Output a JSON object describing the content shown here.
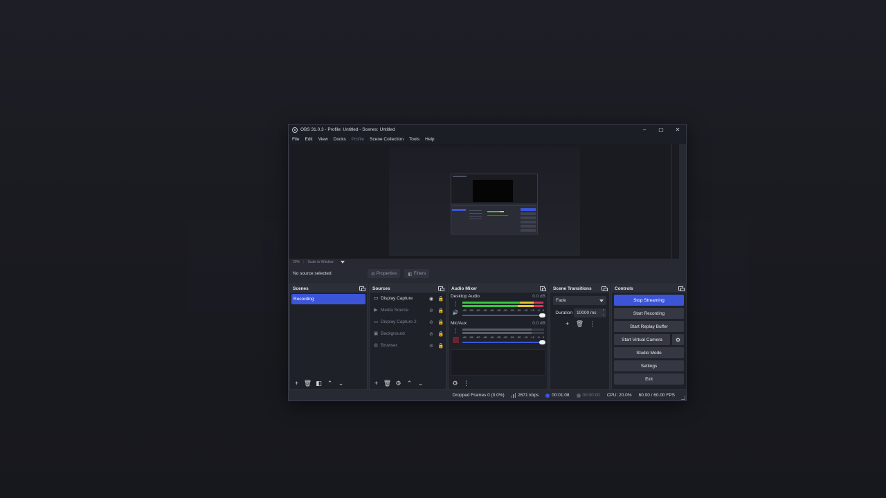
{
  "window": {
    "title": "OBS 31.0.3 - Profile: Untitled - Scenes: Untitled",
    "controls": {
      "minimize": "–",
      "maximize": "▢",
      "close": "✕"
    }
  },
  "menu": {
    "file": "File",
    "edit": "Edit",
    "view": "View",
    "docks": "Docks",
    "profile": "Profile",
    "scene_collection": "Scene Collection",
    "tools": "Tools",
    "help": "Help"
  },
  "preview": {
    "zoom": "20%",
    "scale_mode": "Scale to Window"
  },
  "properties_bar": {
    "no_source": "No source selected",
    "properties": "Properties",
    "filters": "Filters"
  },
  "scenes": {
    "title": "Scenes",
    "items": [
      {
        "label": "Recording",
        "selected": true
      }
    ]
  },
  "sources": {
    "title": "Sources",
    "items": [
      {
        "label": "Display Capture",
        "icon": "monitor-icon",
        "visible": true
      },
      {
        "label": "Media Source",
        "icon": "play-icon",
        "visible": false
      },
      {
        "label": "Display Capture 2",
        "icon": "monitor-icon",
        "visible": false
      },
      {
        "label": "Background",
        "icon": "image-icon",
        "visible": false
      },
      {
        "label": "Browser",
        "icon": "globe-icon",
        "visible": false
      }
    ]
  },
  "audio_mixer": {
    "title": "Audio Mixer",
    "ticks": [
      "-60",
      "-55",
      "-50",
      "-45",
      "-40",
      "-35",
      "-30",
      "-25",
      "-20",
      "-15",
      "-10",
      "-5",
      "0"
    ],
    "channels": [
      {
        "name": "Desktop Audio",
        "db": "0.0 dB",
        "muted": false,
        "volume": 1.0
      },
      {
        "name": "Mic/Aux",
        "db": "0.0 dB",
        "muted": true,
        "volume": 1.0
      }
    ]
  },
  "scene_transitions": {
    "title": "Scene Transitions",
    "transition": "Fade",
    "duration_label": "Duration",
    "duration_value": "10000 ms"
  },
  "controls": {
    "title": "Controls",
    "stop_streaming": "Stop Streaming",
    "start_recording": "Start Recording",
    "start_replay_buffer": "Start Replay Buffer",
    "start_virtual_camera": "Start Virtual Camera",
    "studio_mode": "Studio Mode",
    "settings": "Settings",
    "exit": "Exit"
  },
  "status": {
    "dropped_frames": "Dropped Frames 0 (0.0%)",
    "bitrate": "2671 kbps",
    "stream_time": "00:01:08",
    "record_time": "00:00:00",
    "cpu": "CPU: 20.0%",
    "fps": "60.00 / 60.00 FPS"
  },
  "colors": {
    "accent": "#3b55d6",
    "meter_green": "#37c83c",
    "meter_yellow": "#e2c531",
    "meter_red": "#d6305a"
  }
}
